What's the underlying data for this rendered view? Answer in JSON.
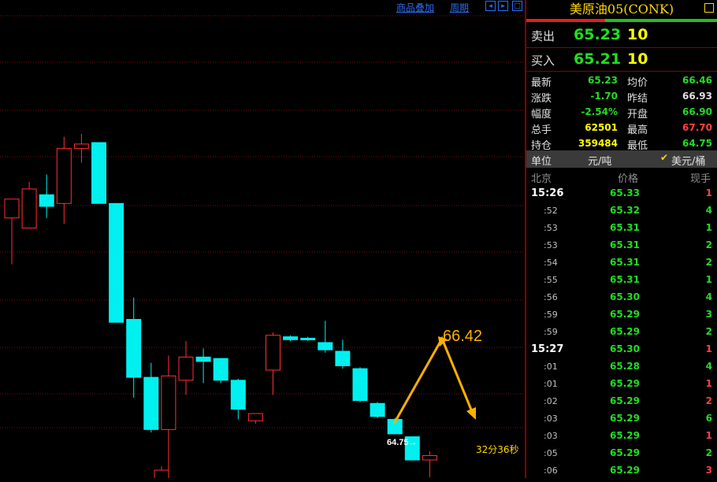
{
  "toolbar": {
    "overlay_label": "商品叠加",
    "period_label": "周期",
    "nav_left": "◂",
    "nav_right": "▸",
    "nav_box": "□"
  },
  "chart_data": {
    "type": "candlestick",
    "price_axis": [
      64.0,
      68.5
    ],
    "candles": [
      {
        "o": 66.42,
        "h": 66.5,
        "l": 66.1,
        "c": 66.55
      },
      {
        "o": 66.35,
        "h": 66.67,
        "l": 66.38,
        "c": 66.62
      },
      {
        "o": 66.58,
        "h": 66.72,
        "l": 66.42,
        "c": 66.5
      },
      {
        "o": 66.52,
        "h": 66.98,
        "l": 66.38,
        "c": 66.9
      },
      {
        "o": 66.9,
        "h": 67.0,
        "l": 66.8,
        "c": 66.93
      },
      {
        "o": 66.94,
        "h": 66.94,
        "l": 66.52,
        "c": 66.52
      },
      {
        "o": 66.52,
        "h": 66.52,
        "l": 65.73,
        "c": 65.7
      },
      {
        "o": 65.72,
        "h": 65.87,
        "l": 65.18,
        "c": 65.32
      },
      {
        "o": 65.32,
        "h": 65.42,
        "l": 64.94,
        "c": 64.96
      },
      {
        "o": 64.96,
        "h": 65.47,
        "l": 64.62,
        "c": 65.33
      },
      {
        "o": 65.3,
        "h": 65.57,
        "l": 65.2,
        "c": 65.46
      },
      {
        "o": 65.46,
        "h": 65.52,
        "l": 65.28,
        "c": 65.43
      },
      {
        "o": 65.45,
        "h": 65.45,
        "l": 65.28,
        "c": 65.3
      },
      {
        "o": 65.3,
        "h": 65.31,
        "l": 65.03,
        "c": 65.1
      },
      {
        "o": 65.02,
        "h": 65.05,
        "l": 65.0,
        "c": 65.07
      },
      {
        "o": 65.37,
        "h": 65.63,
        "l": 65.2,
        "c": 65.61
      },
      {
        "o": 65.6,
        "h": 65.61,
        "l": 65.57,
        "c": 65.58
      },
      {
        "o": 65.59,
        "h": 65.6,
        "l": 65.57,
        "c": 65.58
      },
      {
        "o": 65.56,
        "h": 65.71,
        "l": 65.49,
        "c": 65.51
      },
      {
        "o": 65.5,
        "h": 65.58,
        "l": 65.38,
        "c": 65.4
      },
      {
        "o": 65.38,
        "h": 65.39,
        "l": 65.15,
        "c": 65.16
      },
      {
        "o": 65.14,
        "h": 65.15,
        "l": 65.04,
        "c": 65.05
      },
      {
        "o": 65.03,
        "h": 65.04,
        "l": 64.93,
        "c": 64.93
      },
      {
        "o": 64.91,
        "h": 64.91,
        "l": 64.75,
        "c": 64.75
      },
      {
        "o": 64.75,
        "h": 64.81,
        "l": 64.63,
        "c": 64.78
      }
    ],
    "annotations": {
      "high_label": "66.42",
      "low_label": "64.75→",
      "timer": "32分36秒"
    }
  },
  "panel": {
    "title": "美原油05(CONK)",
    "sell": {
      "label": "卖出",
      "price": "65.23",
      "volume": "10"
    },
    "buy": {
      "label": "买入",
      "price": "65.21",
      "volume": "10"
    },
    "quote_left": [
      {
        "label": "最新",
        "value": "65.23",
        "color": "#22dd22"
      },
      {
        "label": "涨跌",
        "value": "-1.70",
        "color": "#22dd22"
      },
      {
        "label": "幅度",
        "value": "-2.54%",
        "color": "#22dd22"
      },
      {
        "label": "总手",
        "value": "62501",
        "color": "#ffff00"
      },
      {
        "label": "持仓",
        "value": "359484",
        "color": "#ffff00"
      }
    ],
    "quote_right": [
      {
        "label": "均价",
        "value": "66.46",
        "color": "#22dd22"
      },
      {
        "label": "昨结",
        "value": "66.93",
        "color": "#e0e0e0"
      },
      {
        "label": "开盘",
        "value": "66.90",
        "color": "#22dd22"
      },
      {
        "label": "最高",
        "value": "67.70",
        "color": "#ff4040"
      },
      {
        "label": "最低",
        "value": "64.75",
        "color": "#22dd22"
      }
    ],
    "unit": {
      "label": "单位",
      "option1": "元/吨",
      "option2": "美元/桶"
    },
    "ticks_header": {
      "time": "北京",
      "price": "价格",
      "volume": "现手"
    },
    "ticks": [
      {
        "time": "15:26",
        "price": "65.33",
        "vol": "1",
        "vc": "#ff4040",
        "full": true
      },
      {
        "time": ":52",
        "price": "65.32",
        "vol": "4",
        "vc": "#22dd22",
        "full": false
      },
      {
        "time": ":53",
        "price": "65.31",
        "vol": "1",
        "vc": "#22dd22",
        "full": false
      },
      {
        "time": ":53",
        "price": "65.31",
        "vol": "2",
        "vc": "#22dd22",
        "full": false
      },
      {
        "time": ":54",
        "price": "65.31",
        "vol": "2",
        "vc": "#22dd22",
        "full": false
      },
      {
        "time": ":55",
        "price": "65.31",
        "vol": "1",
        "vc": "#22dd22",
        "full": false
      },
      {
        "time": ":56",
        "price": "65.30",
        "vol": "4",
        "vc": "#22dd22",
        "full": false
      },
      {
        "time": ":59",
        "price": "65.29",
        "vol": "3",
        "vc": "#22dd22",
        "full": false
      },
      {
        "time": ":59",
        "price": "65.29",
        "vol": "2",
        "vc": "#22dd22",
        "full": false
      },
      {
        "time": "15:27",
        "price": "65.30",
        "vol": "1",
        "vc": "#ff4040",
        "full": true
      },
      {
        "time": ":01",
        "price": "65.28",
        "vol": "4",
        "vc": "#22dd22",
        "full": false
      },
      {
        "time": ":01",
        "price": "65.29",
        "vol": "1",
        "vc": "#ff4040",
        "full": false
      },
      {
        "time": ":02",
        "price": "65.29",
        "vol": "2",
        "vc": "#ff4040",
        "full": false
      },
      {
        "time": ":03",
        "price": "65.29",
        "vol": "6",
        "vc": "#22dd22",
        "full": false
      },
      {
        "time": ":03",
        "price": "65.29",
        "vol": "1",
        "vc": "#ff4040",
        "full": false
      },
      {
        "time": ":05",
        "price": "65.29",
        "vol": "2",
        "vc": "#22dd22",
        "full": false
      },
      {
        "time": ":06",
        "price": "65.29",
        "vol": "3",
        "vc": "#ff4040",
        "full": false
      }
    ]
  }
}
